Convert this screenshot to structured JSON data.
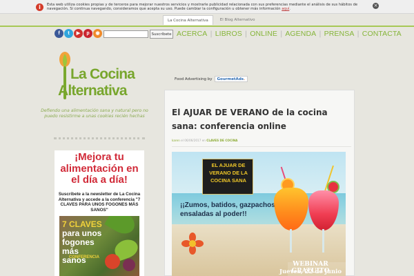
{
  "cookie_bar": {
    "text": "Esta web utiliza cookies propias y de terceros para mejorar nuestros servicios y mostrarle publicidad relacionada con sus preferencias mediante el análisis de sus hábitos de navegación. Si continua navegando, consideramos que acepta su uso. Puede cambiar la configuración u obtener más información",
    "link_label": "aquí"
  },
  "top_tabs": [
    {
      "label": "La Cocina Alternativa",
      "active": true
    },
    {
      "label": "El Blog Alternativo",
      "active": false
    }
  ],
  "social_icons": [
    {
      "name": "facebook-icon",
      "glyph": "f",
      "color": "#3b5998"
    },
    {
      "name": "twitter-icon",
      "glyph": "t",
      "color": "#30a5dd"
    },
    {
      "name": "youtube-icon",
      "glyph": "▶",
      "color": "#d0312d"
    },
    {
      "name": "pinterest-icon",
      "glyph": "p",
      "color": "#c9242e"
    },
    {
      "name": "rss-icon",
      "glyph": "◉",
      "color": "#f08a2a"
    }
  ],
  "search": {
    "value": "",
    "button_label": "Suscríbete"
  },
  "nav_menu": [
    "ACERCA",
    "LIBROS",
    "ONLINE",
    "AGENDA",
    "PRENSA",
    "CONTACTA"
  ],
  "logo": {
    "line1": "La Cocina",
    "line2": "Alternativa"
  },
  "tagline": "Defiendo una alimentación sana y natural pero no puedo resistirme a unas cookies recién hechas",
  "sidebar_promo": {
    "title": "¡Mejora tu alimentación en el día a día!",
    "text": "Suscríbete a la newsletter de La Cocina Alternativa y accede a la conferencia \"7 CLAVES PARA UNOS FOGONES MÁS SANOS\"",
    "image_heading_line1": "7 CLAVES",
    "image_heading_line2": "para unos fogones más sanos",
    "image_label": "CONFERENCIA"
  },
  "ad": {
    "label": "Food Advertising by",
    "brand": "GourmetAds",
    "brand_dot": "."
  },
  "post": {
    "title": "El AJUAR DE VERANO de la cocina sana: conferencia online",
    "meta_author": "karen",
    "meta_date_prefix": "el",
    "meta_date": "06/06/2017",
    "meta_in": "en",
    "meta_category": "CLAVES DE COCINA"
  },
  "post_image": {
    "banner": "EL AJUAR DE VERANO DE LA COCINA SANA",
    "drinks_text": "¡¡Zumos, batidos, gazpachos y ensaladas al poder!!",
    "webinar_title": "WEBINAR GRATUITO",
    "webinar_date": "Jueves, 22 de junio"
  },
  "colors": {
    "accent_green": "#86b53a",
    "promo_red": "#d12a38",
    "banner_yellow": "#f0c829"
  }
}
